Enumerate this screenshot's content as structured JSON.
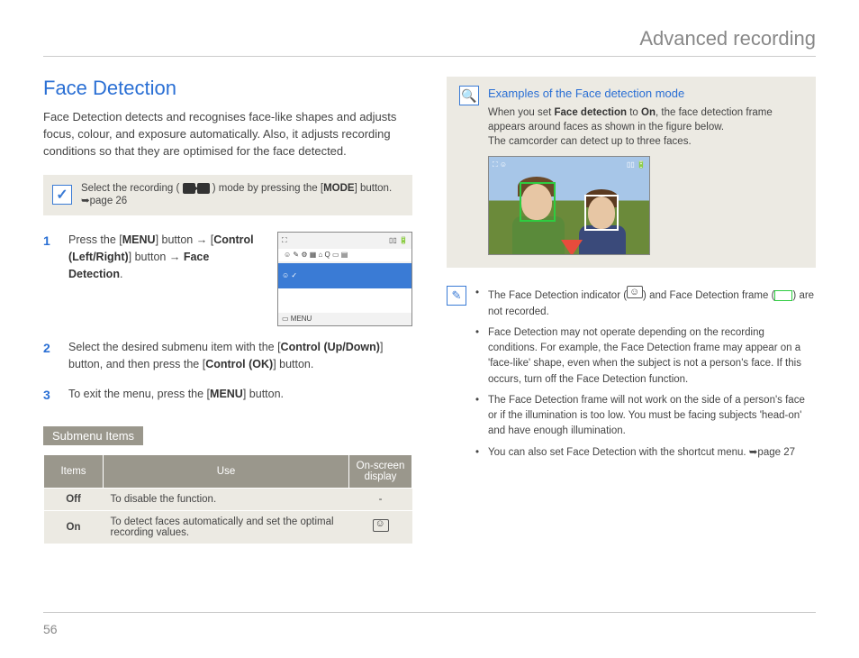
{
  "header": {
    "title": "Advanced recording"
  },
  "left": {
    "heading": "Face Detection",
    "intro": "Face Detection detects and recognises face-like shapes and adjusts focus, colour, and exposure automatically. Also, it adjusts recording conditions so that they are optimised for the face detected.",
    "note_pre": "Select the recording (",
    "note_post": ") mode by pressing the [",
    "note_bold": "MODE",
    "note_end": "] button. ➥page 26",
    "steps": {
      "s1a": "Press the [",
      "s1b": "MENU",
      "s1c": "] button → [",
      "s1d": "Control (Left/Right)",
      "s1e": "] button → ",
      "s1f": "Face Detection",
      "s1g": ".",
      "s2a": "Select the desired submenu item with the [",
      "s2b": "Control (Up/Down)",
      "s2c": "] button, and then press the [",
      "s2d": "Control (OK)",
      "s2e": "] button.",
      "s3a": "To exit the menu, press the [",
      "s3b": "MENU",
      "s3c": "] button."
    },
    "submenu_heading": "Submenu Items",
    "table": {
      "h1": "Items",
      "h2": "Use",
      "h3": "On-screen display",
      "r1c1": "Off",
      "r1c2": "To disable the function.",
      "r1c3": "-",
      "r2c1": "On",
      "r2c2": "To detect faces automatically and set the optimal recording values."
    }
  },
  "right": {
    "ex_title": "Examples of the Face detection mode",
    "ex_l1a": "When you set ",
    "ex_l1b": "Face detection",
    "ex_l1c": " to ",
    "ex_l1d": "On",
    "ex_l1e": ", the face detection frame appears around faces as shown in the figure below.",
    "ex_l2": "The camcorder can detect up to three faces.",
    "tips": {
      "t1a": "The Face Detection indicator (",
      "t1b": ") and Face Detection frame (",
      "t1c": ") are not recorded.",
      "t2": "Face Detection may not operate depending on the recording conditions. For example, the Face Detection frame may appear on a 'face-like' shape, even when the subject is not a person's face. If this occurs, turn off the Face Detection function.",
      "t3": "The Face Detection frame will not work on the side of a person's face or if the illumination is too low. You must be facing subjects 'head-on' and have enough illumination.",
      "t4": "You can also set Face Detection with the shortcut menu. ➥page 27"
    }
  },
  "page_number": "56"
}
